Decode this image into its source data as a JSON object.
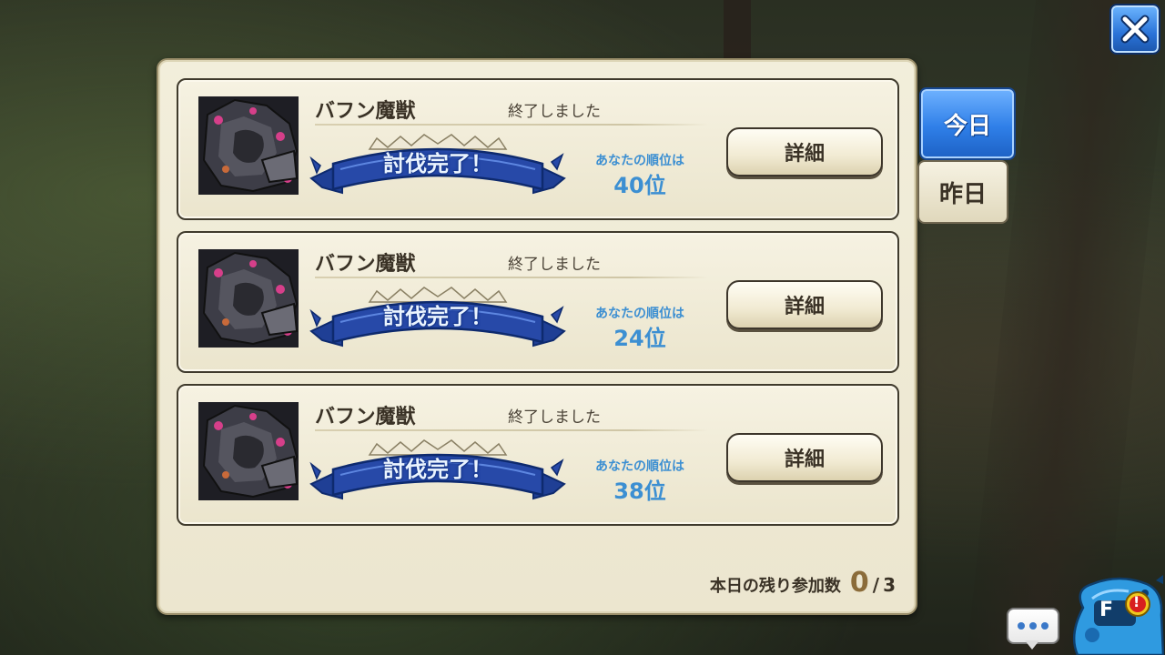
{
  "panel": {
    "entries": [
      {
        "boss_name": "バフン魔獣",
        "status": "終了しました",
        "result_banner": "討伐完了！",
        "rank_label": "あなたの順位は",
        "rank_value": "40位",
        "detail_label": "詳細"
      },
      {
        "boss_name": "バフン魔獣",
        "status": "終了しました",
        "result_banner": "討伐完了！",
        "rank_label": "あなたの順位は",
        "rank_value": "24位",
        "detail_label": "詳細"
      },
      {
        "boss_name": "バフン魔獣",
        "status": "終了しました",
        "result_banner": "討伐完了！",
        "rank_label": "あなたの順位は",
        "rank_value": "38位",
        "detail_label": "詳細"
      }
    ],
    "remaining": {
      "label": "本日の残り参加数",
      "current": "0",
      "separator": "/",
      "max": "3"
    }
  },
  "tabs": [
    {
      "label": "今日",
      "active": true
    },
    {
      "label": "昨日",
      "active": false
    }
  ],
  "icons": {
    "close": "close-icon",
    "chat": "chat-bubble-icon",
    "alert": "alert-icon",
    "mascot_letter": "F"
  },
  "colors": {
    "accent_blue": "#2f7fe8",
    "rank_text": "#3c8fd2",
    "panel_bg": "#f2eedb",
    "ribbon_blue": "#2749a8",
    "alert_red": "#d81f1f"
  }
}
